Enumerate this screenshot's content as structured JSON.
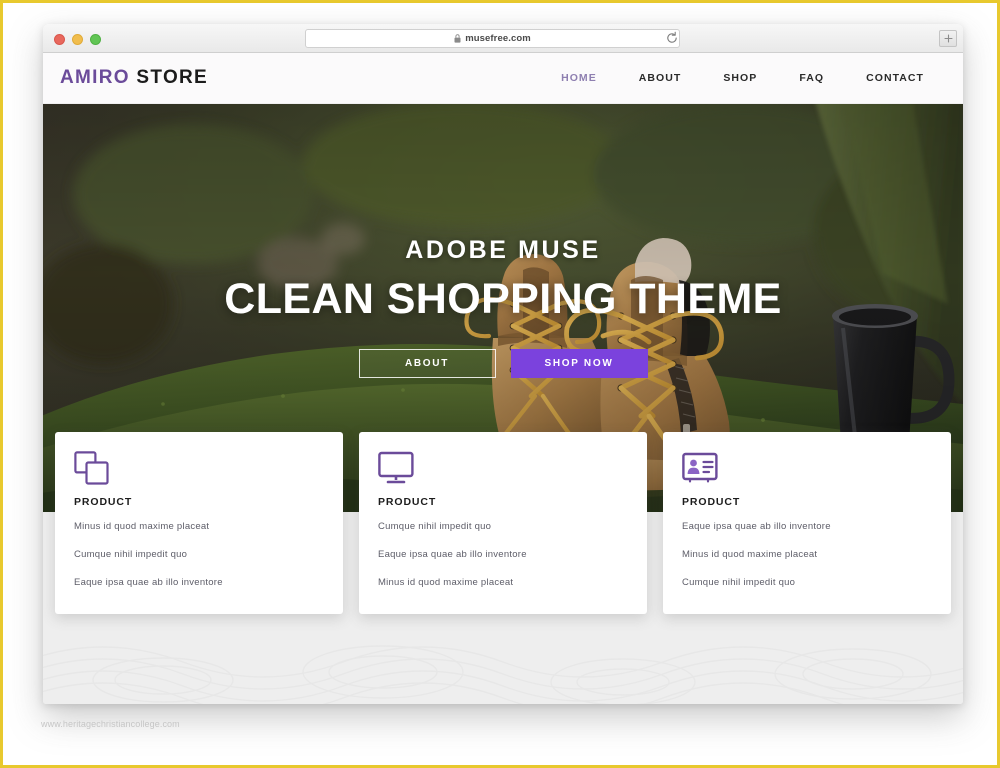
{
  "frame": {
    "border_color": "#e8c92e"
  },
  "browser": {
    "traffic_lights": [
      "close",
      "minimize",
      "maximize"
    ],
    "url": "musefree.com",
    "lock_icon": "lock-icon",
    "reload_icon": "reload-icon",
    "newtab_label": "+"
  },
  "site": {
    "brand": {
      "first": "AMIRO",
      "second": "STORE",
      "accent": "#6b4b9a"
    },
    "nav": [
      {
        "label": "HOME",
        "active": true
      },
      {
        "label": "ABOUT",
        "active": false
      },
      {
        "label": "SHOP",
        "active": false
      },
      {
        "label": "FAQ",
        "active": false
      },
      {
        "label": "CONTACT",
        "active": false
      }
    ]
  },
  "hero": {
    "kicker": "ADOBE MUSE",
    "title": "CLEAN SHOPPING THEME",
    "buttons": {
      "ghost": "ABOUT",
      "solid": "SHOP NOW"
    },
    "accent_color": "#7b42dd",
    "photo_description": "brown hiking boots on mossy rock with dark metal mug"
  },
  "features": [
    {
      "icon": "copy-icon",
      "title": "PRODUCT",
      "lines": [
        "Minus id quod maxime placeat",
        "Cumque nihil impedit quo",
        "Eaque ipsa quae ab illo inventore"
      ]
    },
    {
      "icon": "monitor-icon",
      "title": "PRODUCT",
      "lines": [
        "Cumque nihil impedit quo",
        "Eaque ipsa quae ab illo inventore",
        "Minus id quod maxime placeat"
      ]
    },
    {
      "icon": "id-card-icon",
      "title": "PRODUCT",
      "lines": [
        "Eaque ipsa quae ab illo inventore",
        "Minus id quod maxime placeat",
        "Cumque nihil impedit quo"
      ]
    }
  ],
  "watermark": "www.heritagechristiancollege.com"
}
